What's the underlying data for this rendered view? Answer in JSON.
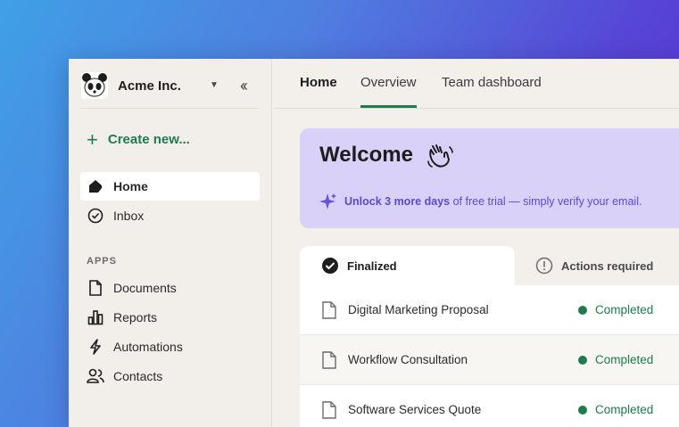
{
  "org": {
    "name": "Acme Inc."
  },
  "sidebar": {
    "create_label": "Create new...",
    "items": [
      {
        "label": "Home"
      },
      {
        "label": "Inbox"
      }
    ],
    "apps_label": "APPS",
    "apps": [
      {
        "label": "Documents"
      },
      {
        "label": "Reports"
      },
      {
        "label": "Automations"
      },
      {
        "label": "Contacts"
      }
    ]
  },
  "tabs": [
    {
      "label": "Home"
    },
    {
      "label": "Overview"
    },
    {
      "label": "Team dashboard"
    }
  ],
  "banner": {
    "title": "Welcome",
    "highlight": "Unlock 3 more days",
    "message": " of free trial — simply verify your email."
  },
  "doc_tabs": [
    {
      "label": "Finalized"
    },
    {
      "label": "Actions required"
    }
  ],
  "documents": [
    {
      "title": "Digital Marketing Proposal",
      "status": "Completed"
    },
    {
      "title": "Workflow Consultation",
      "status": "Completed"
    },
    {
      "title": "Software Services Quote",
      "status": "Completed"
    }
  ],
  "colors": {
    "accent": "#1f7a4d",
    "banner_bg": "#d9d1f8",
    "banner_text": "#5b4ac4"
  },
  "icons": {
    "logo": "panda-logo-icon",
    "caret": "chevron-down-icon",
    "collapse": "double-chevron-left-icon",
    "create": "plus-icon",
    "home": "home-icon",
    "inbox": "check-circle-icon",
    "documents": "document-icon",
    "reports": "bar-chart-icon",
    "automations": "lightning-icon",
    "contacts": "users-icon",
    "wave": "waving-hand-icon",
    "spark": "sparkle-icon",
    "finalized": "check-circle-filled-icon",
    "actions_required": "exclamation-circle-icon",
    "file": "file-icon"
  }
}
